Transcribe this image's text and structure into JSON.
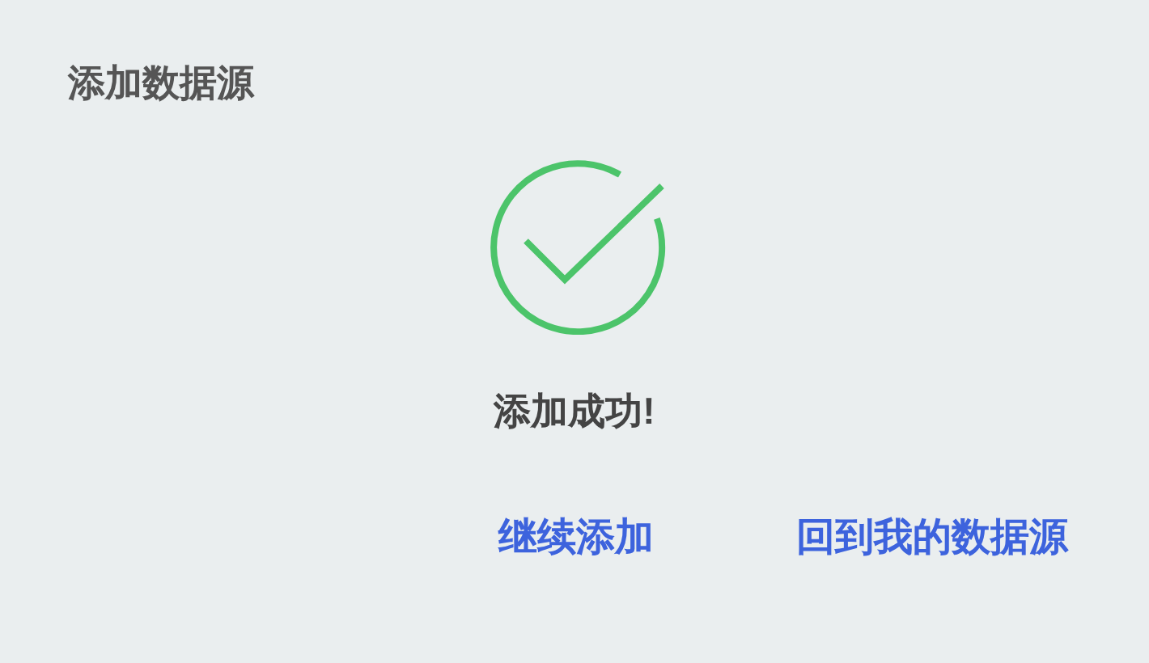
{
  "title": "添加数据源",
  "result": {
    "message": "添加成功!"
  },
  "actions": [
    {
      "label": "继续添加"
    },
    {
      "label": "回到我的数据源"
    }
  ]
}
